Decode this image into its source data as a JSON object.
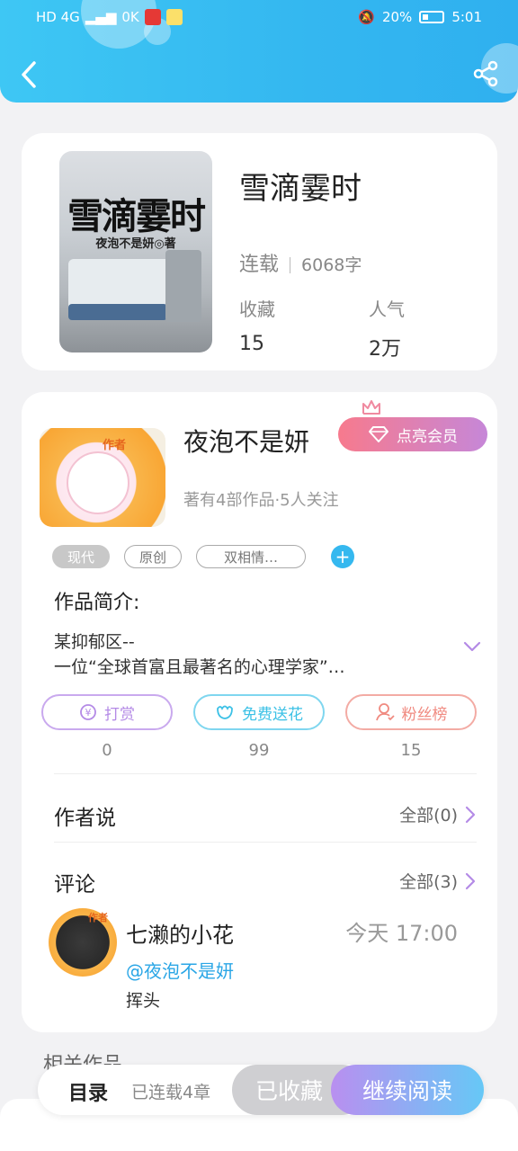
{
  "status_bar": {
    "left_text": "HD 4G",
    "speed": "0K",
    "battery": "20%",
    "time": "5:01"
  },
  "header": {
    "back_icon": "back-arrow-icon",
    "share_icon": "share-icon",
    "colors": {
      "bg_start": "#3ec7f4",
      "bg_end": "#2fb0ef"
    }
  },
  "book": {
    "cover_title": "雪滴霎时",
    "cover_author": "夜泡不是妍◎著",
    "title": "雪滴霎时",
    "status": "连载",
    "words": "6068字",
    "stats": [
      {
        "label": "收藏",
        "value": "15"
      },
      {
        "label": "人气",
        "value": "2万"
      }
    ]
  },
  "author": {
    "avatar_tag": "作者",
    "name": "夜泡不是妍",
    "vip_button": "点亮会员",
    "summary": "著有4部作品·5人关注",
    "tags": [
      "现代",
      "原创",
      "双相情…"
    ]
  },
  "intro": {
    "label": "作品简介:",
    "lines": [
      "某抑郁区--",
      "一位“全球首富且最著名的心理学家”…"
    ]
  },
  "actions": [
    {
      "label": "打赏",
      "count": "0",
      "icon": "coin-icon",
      "color": "#b48ae6"
    },
    {
      "label": "免费送花",
      "count": "99",
      "icon": "flower-icon",
      "color": "#3cc1e6"
    },
    {
      "label": "粉丝榜",
      "count": "15",
      "icon": "fan-icon",
      "color": "#f08a80"
    }
  ],
  "author_says": {
    "title": "作者说",
    "more": "全部(0)"
  },
  "comments": {
    "title": "评论",
    "more": "全部(3)",
    "items": [
      {
        "avatar_tag": "作者",
        "name": "七濑的小花",
        "time": "今天 17:00",
        "mention": "@夜泡不是妍",
        "text": "挥头"
      }
    ]
  },
  "related_title": "相关作品",
  "bottom_bar": {
    "toc": "目录",
    "serial": "已连载4章",
    "favorited": "已收藏",
    "continue": "继续阅读"
  }
}
